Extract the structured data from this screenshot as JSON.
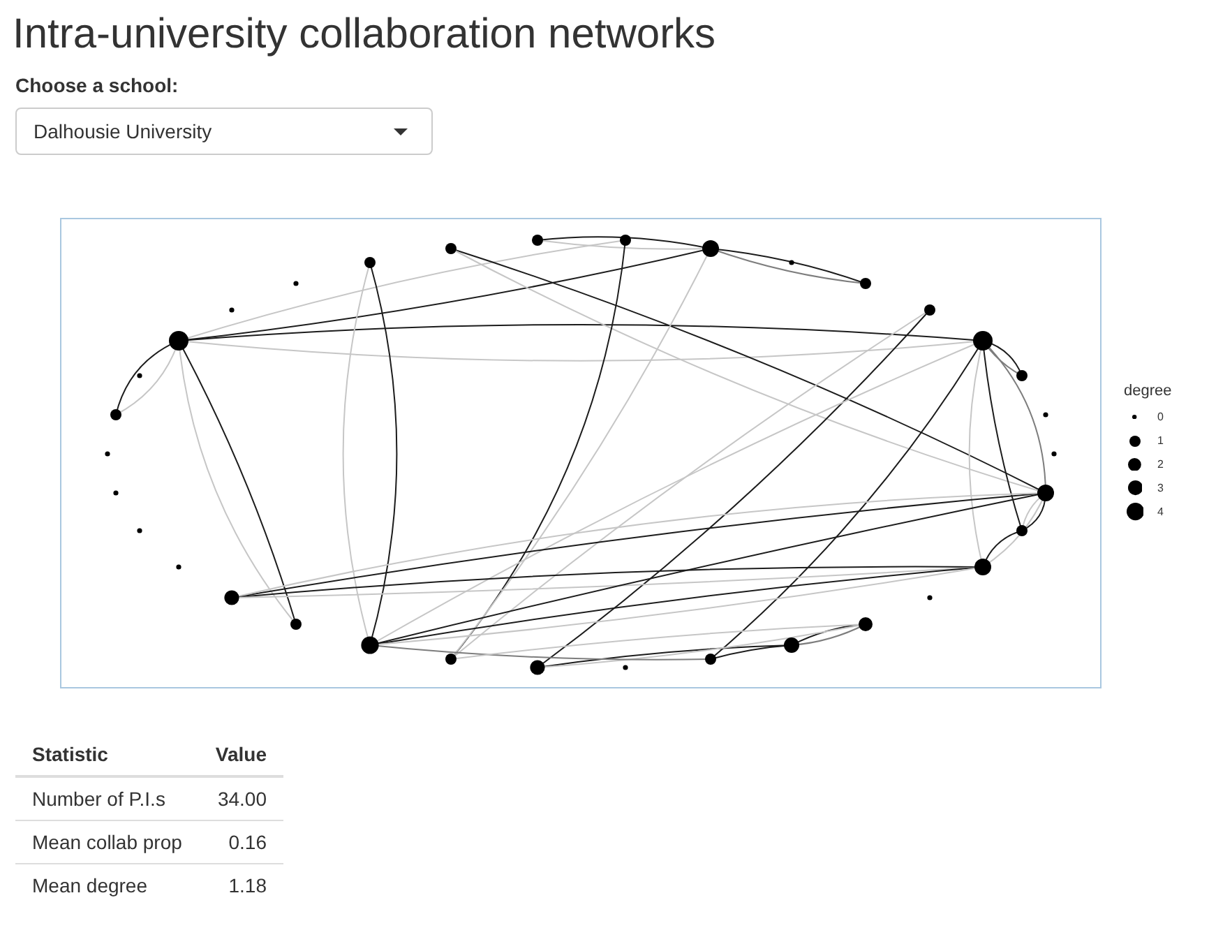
{
  "title": "Intra-university collaboration networks",
  "school_select": {
    "label": "Choose a school:",
    "value": "Dalhousie University"
  },
  "network_plot": {
    "legend": {
      "title": "degree",
      "items": [
        {
          "label": "0"
        },
        {
          "label": "1"
        },
        {
          "label": "2"
        },
        {
          "label": "3"
        },
        {
          "label": "4"
        }
      ]
    }
  },
  "stats_table": {
    "columns": [
      "Statistic",
      "Value"
    ],
    "rows": [
      {
        "statistic": "Number of P.I.s",
        "value": "34.00"
      },
      {
        "statistic": "Mean collab prop",
        "value": "0.16"
      },
      {
        "statistic": "Mean degree",
        "value": "1.18"
      }
    ]
  }
}
